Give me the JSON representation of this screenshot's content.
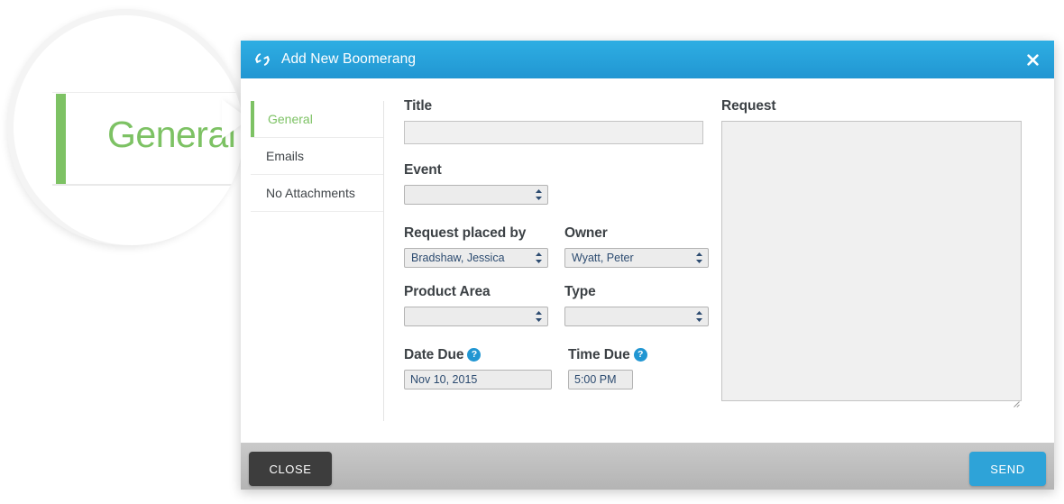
{
  "magnifier": {
    "zoom_label": "General",
    "accent_color": "#7dc264"
  },
  "dialog": {
    "title": "Add New Boomerang",
    "title_icon": "boomerang-refresh-icon",
    "close_icon": "close-x-icon",
    "header_color": "#2196d2"
  },
  "sidebar": {
    "items": [
      {
        "label": "General",
        "active": true
      },
      {
        "label": "Emails",
        "active": false
      },
      {
        "label": "No Attachments",
        "active": false
      }
    ]
  },
  "form": {
    "title": {
      "label": "Title",
      "value": "",
      "placeholder": ""
    },
    "event": {
      "label": "Event",
      "value": ""
    },
    "request_placed_by": {
      "label": "Request placed by",
      "value": "Bradshaw, Jessica"
    },
    "owner": {
      "label": "Owner",
      "value": "Wyatt, Peter"
    },
    "product_area": {
      "label": "Product Area",
      "value": ""
    },
    "type": {
      "label": "Type",
      "value": ""
    },
    "date_due": {
      "label": "Date Due",
      "value": "Nov 10, 2015",
      "help_icon": "help-question-icon",
      "help_glyph": "?"
    },
    "time_due": {
      "label": "Time Due",
      "value": "5:00 PM",
      "help_icon": "help-question-icon",
      "help_glyph": "?"
    },
    "request": {
      "label": "Request",
      "value": "",
      "placeholder": ""
    }
  },
  "footer": {
    "close_label": "CLOSE",
    "send_label": "SEND",
    "send_color": "#2ea3d8",
    "close_color": "#3d3d3d"
  }
}
